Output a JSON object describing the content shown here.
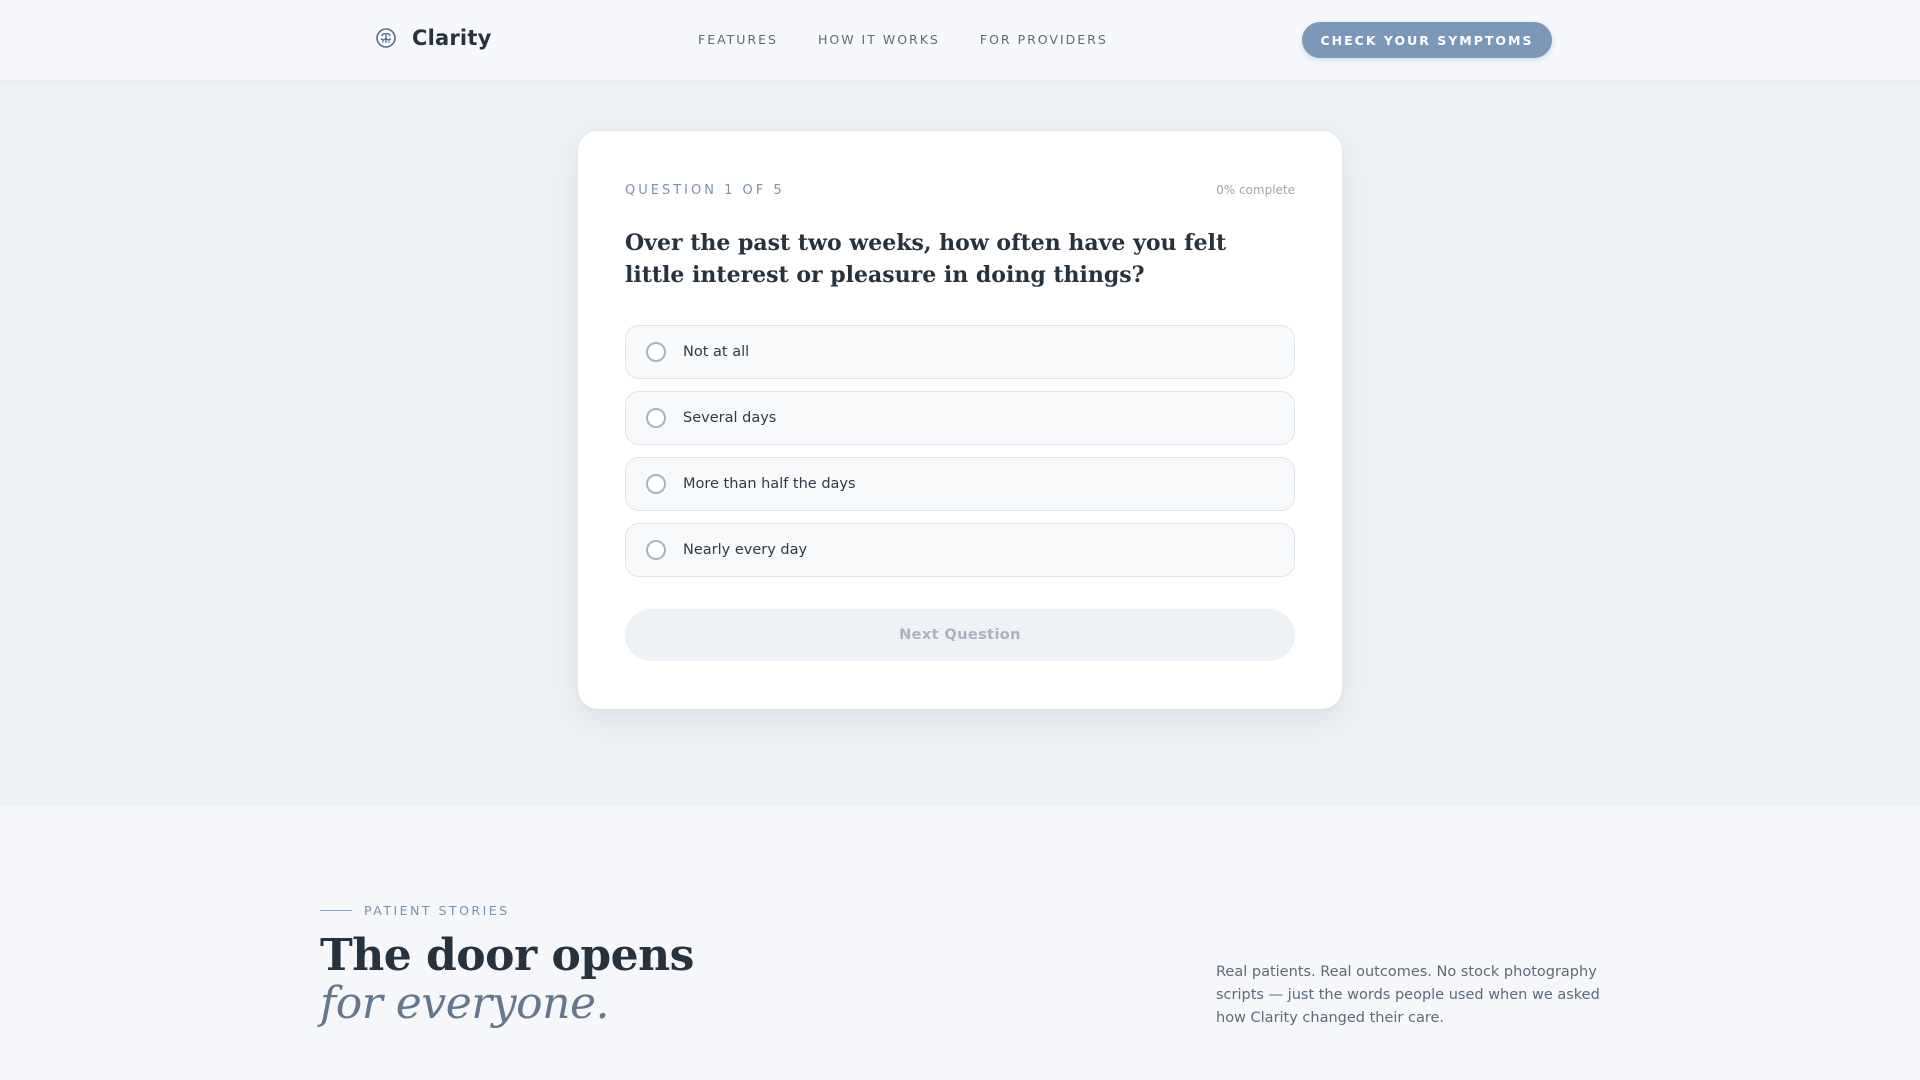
{
  "brand": {
    "name": "Clarity",
    "logo_icon": "brain-icon",
    "accent_color": "#7b98b9"
  },
  "nav": {
    "items": [
      {
        "label": "FEATURES"
      },
      {
        "label": "HOW IT WORKS"
      },
      {
        "label": "FOR PROVIDERS"
      }
    ],
    "cta_label": "CHECK YOUR SYMPTOMS"
  },
  "quiz": {
    "progress_label": "QUESTION 1 OF 5",
    "percent_label": "0% complete",
    "question": "Over the past two weeks, how often have you felt little interest or pleasure in doing things?",
    "options": [
      {
        "label": "Not at all",
        "selected": false
      },
      {
        "label": "Several days",
        "selected": false
      },
      {
        "label": "More than half the days",
        "selected": false
      },
      {
        "label": "Nearly every day",
        "selected": false
      }
    ],
    "next_label": "Next Question",
    "next_enabled": false
  },
  "stories": {
    "eyebrow": "PATIENT STORIES",
    "headline": "The door opens",
    "headline_italic": "for everyone.",
    "description": "Real patients. Real outcomes. No stock photography scripts — just the words people used when we asked how Clarity changed their care."
  }
}
